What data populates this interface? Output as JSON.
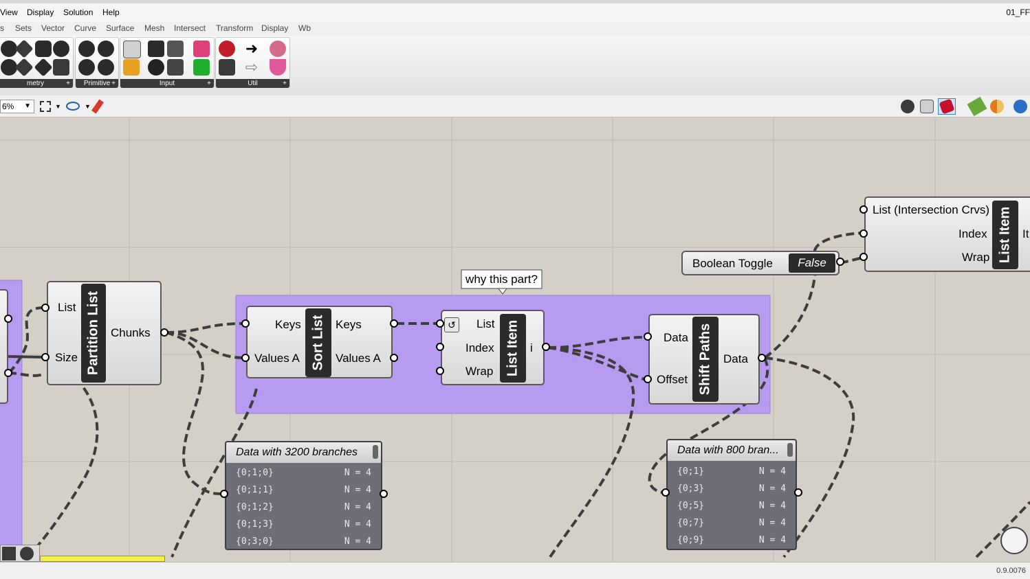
{
  "menu": {
    "items": [
      "View",
      "Display",
      "Solution",
      "Help"
    ],
    "doc_title": "01_FF"
  },
  "tabs": [
    "s",
    "Sets",
    "Vector",
    "Curve",
    "Surface",
    "Mesh",
    "Intersect",
    "Transform",
    "Display",
    "Wb"
  ],
  "ribbon": {
    "groups": [
      "metry",
      "Primitive",
      "Input",
      "Util"
    ]
  },
  "toolbar": {
    "zoom": "6%"
  },
  "status": {
    "version": "0.9.0076"
  },
  "canvas": {
    "partition_list": {
      "title": "Partition List",
      "inputs": [
        "List",
        "Size"
      ],
      "outputs": [
        "Chunks"
      ]
    },
    "sort_list": {
      "title": "Sort List",
      "inputs": [
        "Keys",
        "Values A"
      ],
      "outputs": [
        "Keys",
        "Values A"
      ]
    },
    "list_item_mid": {
      "title": "List Item",
      "inputs": [
        "List",
        "Index",
        "Wrap"
      ],
      "outputs": [
        "i"
      ]
    },
    "shift_paths": {
      "title": "Shift Paths",
      "inputs": [
        "Data",
        "Offset"
      ],
      "outputs": [
        "Data"
      ]
    },
    "list_item_top": {
      "title": "List Item",
      "inputs": [
        "List (Intersection Crvs)",
        "Index",
        "Wrap"
      ],
      "outputs": [
        "It"
      ]
    },
    "boolean_toggle": {
      "label": "Boolean Toggle",
      "value": "False"
    },
    "scribble": "why this part?",
    "panel_left": {
      "title": "Data with 3200 branches",
      "rows": [
        {
          "path": "{0;1;0}",
          "count": "N = 4"
        },
        {
          "path": "{0;1;1}",
          "count": "N = 4"
        },
        {
          "path": "{0;1;2}",
          "count": "N = 4"
        },
        {
          "path": "{0;1;3}",
          "count": "N = 4"
        },
        {
          "path": "{0;3;0}",
          "count": "N = 4"
        }
      ]
    },
    "panel_right": {
      "title": "Data with 800 bran...",
      "rows": [
        {
          "path": "{0;1}",
          "count": "N = 4"
        },
        {
          "path": "{0;3}",
          "count": "N = 4"
        },
        {
          "path": "{0;5}",
          "count": "N = 4"
        },
        {
          "path": "{0;7}",
          "count": "N = 4"
        },
        {
          "path": "{0;9}",
          "count": "N = 4"
        }
      ]
    }
  },
  "colors": {
    "canvas": "#d4d0c8",
    "group": "#b79bf0",
    "nickname": "#2b2b2b",
    "panel": "#6e6e76"
  }
}
